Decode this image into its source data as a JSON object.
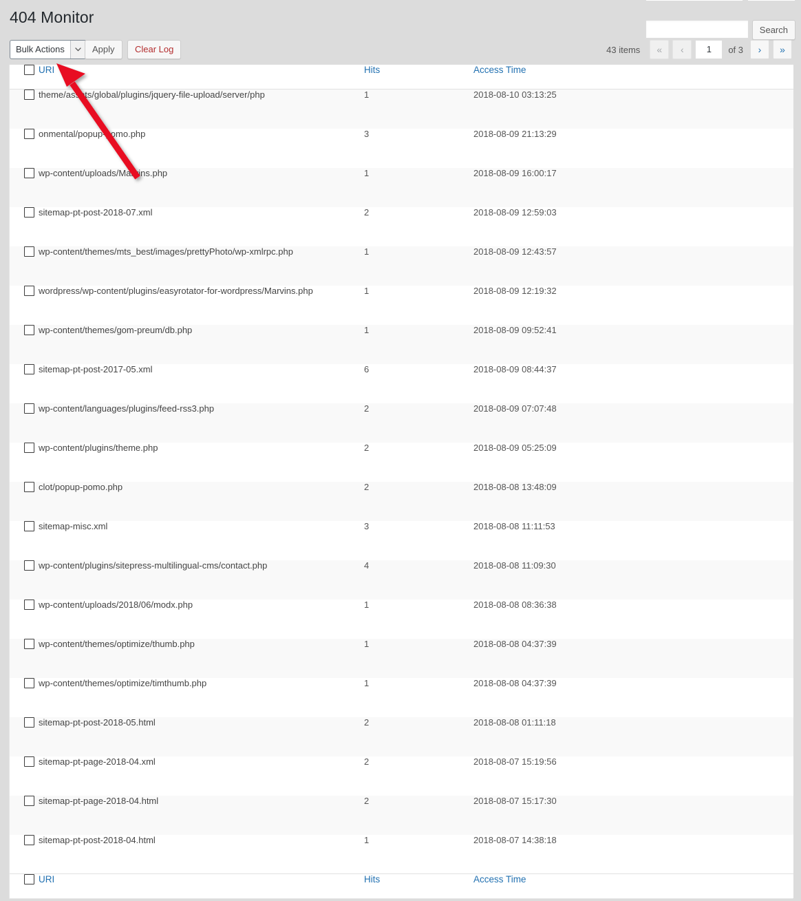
{
  "page": {
    "title": "404 Monitor"
  },
  "search": {
    "value": "",
    "placeholder": "",
    "button_label": "Search"
  },
  "toolbar": {
    "bulk_actions_label": "Bulk Actions",
    "bulk_actions_arrow": "chevron-down-icon",
    "apply_label": "Apply",
    "clear_log_label": "Clear Log",
    "clear_log_color": "#b32d2e"
  },
  "pagination": {
    "items_count": "43 items",
    "first_label": "«",
    "prev_label": "‹",
    "current_page": "1",
    "of_label": "of 3",
    "next_label": "›",
    "last_label": "»",
    "first_disabled": true,
    "prev_disabled": true,
    "next_disabled": false,
    "last_disabled": false
  },
  "table": {
    "columns": [
      "URI",
      "Hits",
      "Access Time"
    ],
    "link_color": "#2271b1",
    "rows": [
      {
        "uri": "theme/assets/global/plugins/jquery-file-upload/server/php",
        "hits": "1",
        "time": "2018-08-10 03:13:25"
      },
      {
        "uri": "onmental/popup-pomo.php",
        "hits": "3",
        "time": "2018-08-09 21:13:29"
      },
      {
        "uri": "wp-content/uploads/Marvins.php",
        "hits": "1",
        "time": "2018-08-09 16:00:17"
      },
      {
        "uri": "sitemap-pt-post-2018-07.xml",
        "hits": "2",
        "time": "2018-08-09 12:59:03"
      },
      {
        "uri": "wp-content/themes/mts_best/images/prettyPhoto/wp-xmlrpc.php",
        "hits": "1",
        "time": "2018-08-09 12:43:57"
      },
      {
        "uri": "wordpress/wp-content/plugins/easyrotator-for-wordpress/Marvins.php",
        "hits": "1",
        "time": "2018-08-09 12:19:32"
      },
      {
        "uri": "wp-content/themes/gom-preum/db.php",
        "hits": "1",
        "time": "2018-08-09 09:52:41"
      },
      {
        "uri": "sitemap-pt-post-2017-05.xml",
        "hits": "6",
        "time": "2018-08-09 08:44:37"
      },
      {
        "uri": "wp-content/languages/plugins/feed-rss3.php",
        "hits": "2",
        "time": "2018-08-09 07:07:48"
      },
      {
        "uri": "wp-content/plugins/theme.php",
        "hits": "2",
        "time": "2018-08-09 05:25:09"
      },
      {
        "uri": "clot/popup-pomo.php",
        "hits": "2",
        "time": "2018-08-08 13:48:09"
      },
      {
        "uri": "sitemap-misc.xml",
        "hits": "3",
        "time": "2018-08-08 11:11:53"
      },
      {
        "uri": "wp-content/plugins/sitepress-multilingual-cms/contact.php",
        "hits": "4",
        "time": "2018-08-08 11:09:30"
      },
      {
        "uri": "wp-content/uploads/2018/06/modx.php",
        "hits": "1",
        "time": "2018-08-08 08:36:38"
      },
      {
        "uri": "wp-content/themes/optimize/thumb.php",
        "hits": "1",
        "time": "2018-08-08 04:37:39"
      },
      {
        "uri": "wp-content/themes/optimize/timthumb.php",
        "hits": "1",
        "time": "2018-08-08 04:37:39"
      },
      {
        "uri": "sitemap-pt-post-2018-05.html",
        "hits": "2",
        "time": "2018-08-08 01:11:18"
      },
      {
        "uri": "sitemap-pt-page-2018-04.xml",
        "hits": "2",
        "time": "2018-08-07 15:19:56"
      },
      {
        "uri": "sitemap-pt-page-2018-04.html",
        "hits": "2",
        "time": "2018-08-07 15:17:30"
      },
      {
        "uri": "sitemap-pt-post-2018-04.html",
        "hits": "1",
        "time": "2018-08-07 14:38:18"
      }
    ]
  },
  "annotation": {
    "arrow_color": "#e81123",
    "arrow_name": "red-pointer-arrow"
  }
}
